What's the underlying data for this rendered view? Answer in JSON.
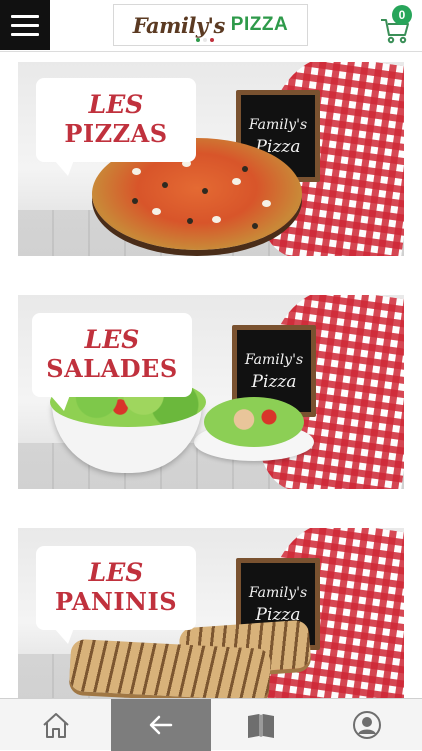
{
  "header": {
    "logo_script": "Family's",
    "logo_word": "PIZZA",
    "cart_count": "0",
    "icons": {
      "menu": "hamburger-menu-icon",
      "cart": "shopping-cart-icon"
    }
  },
  "categories": [
    {
      "line1": "LES",
      "line2": "PIZZAS",
      "board_line1": "Family's",
      "board_line2": "Pizza"
    },
    {
      "line1": "LES",
      "line2": "SALADES",
      "board_line1": "Family's",
      "board_line2": "Pizza"
    },
    {
      "line1": "LES",
      "line2": "PANINIS",
      "board_line1": "Family's",
      "board_line2": "Pizza"
    }
  ],
  "bottom_nav": [
    {
      "icon": "home-icon",
      "active": false
    },
    {
      "icon": "back-arrow-icon",
      "active": true
    },
    {
      "icon": "book-menu-icon",
      "active": false
    },
    {
      "icon": "user-profile-icon",
      "active": false
    }
  ],
  "colors": {
    "header_menu_bg": "#111111",
    "brand_red": "#c0313d",
    "brand_green": "#2e9a4a",
    "badge_green": "#27a55a",
    "nav_active_bg": "#7d7d7d",
    "logo_dots": [
      "#2e9a4a",
      "#ffffff",
      "#c0313d"
    ]
  }
}
